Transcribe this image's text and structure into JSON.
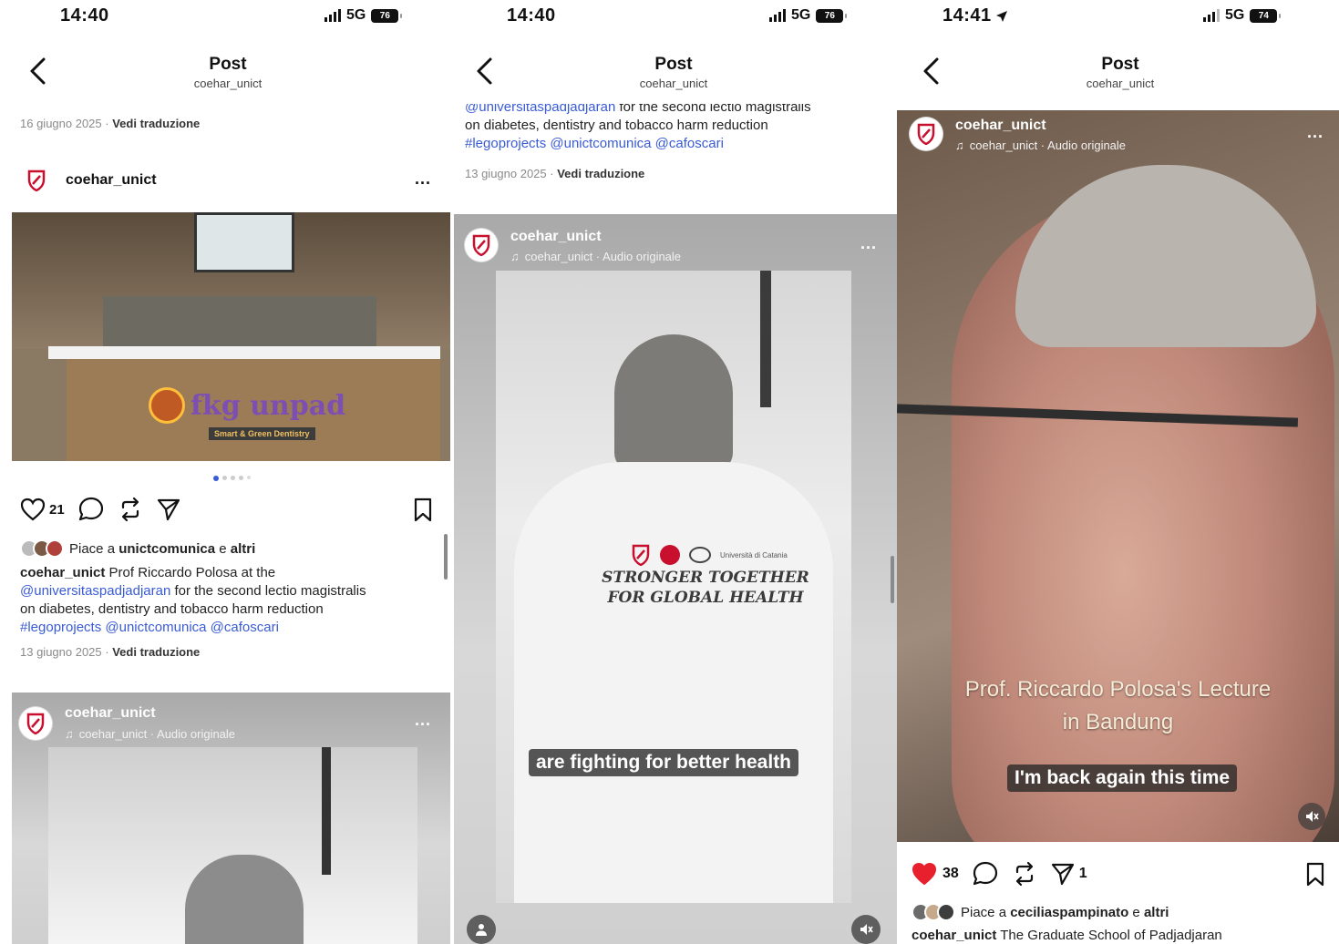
{
  "panel1": {
    "time": "14:40",
    "network": "5G",
    "battery": "76",
    "nav_title": "Post",
    "nav_sub": "coehar_unict",
    "top_date": "16 giugno 2025",
    "top_translate": "Vedi traduzione",
    "post": {
      "username": "coehar_unict",
      "more": "...",
      "sign_logo": "fkg unpad",
      "sign_tagline": "Smart & Green Dentistry",
      "like_count": "21",
      "likes_prefix": "Piace a ",
      "likes_user": "unictcomunica",
      "likes_and": " e ",
      "likes_others": "altri",
      "caption_user": "coehar_unict",
      "caption_text1": " Prof Riccardo Polosa at the",
      "caption_mention1": "@universitaspadjadjaran",
      "caption_text2": " for the second lectio magistralis",
      "caption_text3": "on diabetes, dentistry and tobacco harm reduction",
      "caption_tags": "#legoprojects @unictcomunica @cafoscari",
      "date": "13 giugno 2025",
      "translate": "Vedi traduzione"
    },
    "next_post": {
      "username": "coehar_unict",
      "audio": "coehar_unict · Audio originale",
      "more": "..."
    }
  },
  "panel2": {
    "time": "14:40",
    "network": "5G",
    "battery": "76",
    "nav_title": "Post",
    "nav_sub": "coehar_unict",
    "caption_mention1": "@universitaspadjadjaran",
    "caption_text2": " for the second lectio magistralis",
    "caption_text3": "on diabetes, dentistry and tobacco harm reduction",
    "caption_tags": "#legoprojects @unictcomunica @cafoscari",
    "date": "13 giugno 2025",
    "translate": "Vedi traduzione",
    "video": {
      "username": "coehar_unict",
      "audio": "coehar_unict · Audio originale",
      "more": "...",
      "shirt_line1": "STRONGER TOGETHER",
      "shirt_line2": "FOR GLOBAL HEALTH",
      "shirt_logo_text": "Università di Catania",
      "subtitle": "are fighting for better health"
    }
  },
  "panel3": {
    "time": "14:41",
    "network": "5G",
    "battery": "74",
    "nav_title": "Post",
    "nav_sub": "coehar_unict",
    "video": {
      "username": "coehar_unict",
      "audio": "coehar_unict · Audio originale",
      "more": "...",
      "title_line1": "Prof. Riccardo Polosa's Lecture",
      "title_line2": "in Bandung",
      "subtitle": "I'm back again this time"
    },
    "like_count": "38",
    "share_count": "1",
    "likes_prefix": "Piace a ",
    "likes_user": "ceciliaspampinato",
    "likes_and": " e ",
    "likes_others": "altri",
    "caption_user": "coehar_unict",
    "caption_text": " The Graduate School of Padjadjaran"
  },
  "colors": {
    "accent_link": "#3a5bd6",
    "like_red": "#e8202e",
    "logo_red": "#c8102e"
  }
}
